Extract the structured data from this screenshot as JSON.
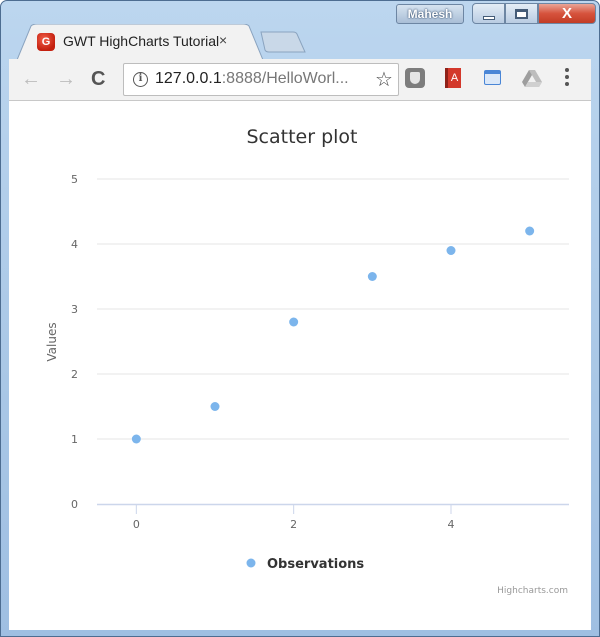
{
  "window": {
    "user_badge": "Mahesh",
    "controls": {
      "minimize": "minimize",
      "maximize": "maximize",
      "close": "X"
    }
  },
  "browser": {
    "tab": {
      "title": "GWT HighCharts Tutorial",
      "close": "×",
      "favicon": "G"
    },
    "toolbar": {
      "back_icon": "←",
      "forward_icon": "→",
      "reload_icon": "C",
      "url_host": "127.0.0.1",
      "url_rest": ":8888/HelloWorl...",
      "info_icon": "i",
      "star_icon": "☆",
      "ext_book_label": "A"
    }
  },
  "colors": {
    "series": "#7cb5ec",
    "grid": "#e6e6e6",
    "axis_line": "#ccd6eb"
  },
  "chart_data": {
    "type": "scatter",
    "title": "Scatter plot",
    "xlabel": "",
    "ylabel": "Values",
    "xlim": [
      -0.5,
      5.5
    ],
    "ylim": [
      0,
      5
    ],
    "x_ticks": [
      0,
      2,
      4
    ],
    "y_ticks": [
      0,
      1,
      2,
      3,
      4,
      5
    ],
    "grid": true,
    "legend": {
      "position": "bottom-center",
      "entries": [
        "Observations"
      ]
    },
    "series": [
      {
        "name": "Observations",
        "x": [
          0,
          1,
          2,
          3,
          4,
          5
        ],
        "y": [
          1,
          1.5,
          2.8,
          3.5,
          3.9,
          4.2
        ]
      }
    ],
    "credits": "Highcharts.com"
  }
}
